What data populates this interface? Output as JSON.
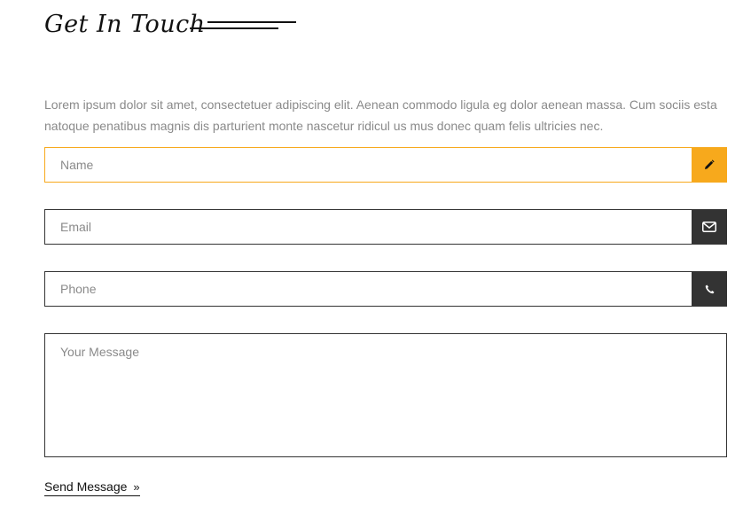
{
  "header": {
    "title": "Get In Touch"
  },
  "intro": {
    "text": "Lorem ipsum dolor sit amet, consectetuer adipiscing elit. Aenean commodo ligula eg dolor aenean massa. Cum sociis esta natoque penatibus magnis dis parturient monte nascetur ridicul us mus donec quam felis ultricies nec."
  },
  "form": {
    "name": {
      "placeholder": "Name",
      "value": "",
      "icon": "pencil-icon"
    },
    "email": {
      "placeholder": "Email",
      "value": "",
      "icon": "envelope-icon"
    },
    "phone": {
      "placeholder": "Phone",
      "value": "",
      "icon": "phone-icon"
    },
    "message": {
      "placeholder": "Your Message",
      "value": ""
    },
    "submit_label": "Send Message",
    "submit_icon": "double-chevron-right-icon"
  },
  "colors": {
    "accent": "#f7a91c",
    "dark": "#333333",
    "muted_text": "#8a8a8a"
  }
}
